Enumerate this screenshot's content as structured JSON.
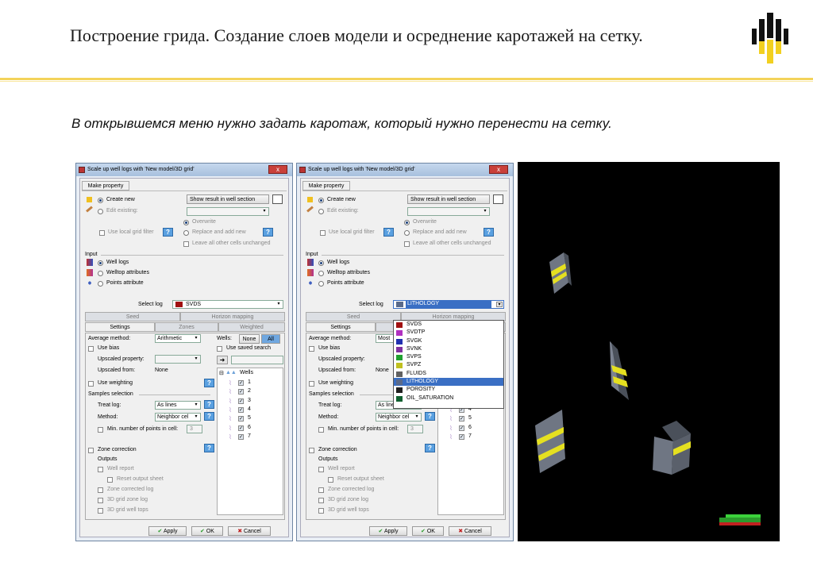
{
  "slide": {
    "title": "Построение грида. Создание слоев модели и осреднение каротажей на сетку.",
    "subtitle": "В открывшемся меню нужно задать каротаж, который нужно перенести на сетку."
  },
  "dialog": {
    "title": "Scale up well logs with 'New model/3D grid'",
    "close": "x",
    "section_tab": "Make property",
    "create_new": "Create new",
    "edit_existing": "Edit existing:",
    "show_result": "Show result in well section",
    "use_local_grid_filter": "Use local grid filter",
    "overwrite": "Overwrite",
    "replace_add": "Replace and add new",
    "leave_cells": "Leave all other cells unchanged",
    "input_label": "Input",
    "well_logs": "Well logs",
    "welltop_attributes": "Welltop attributes",
    "points_attribute": "Points attribute",
    "select_log_label": "Select log",
    "tabs_row1": [
      "Seed",
      "Horizon mapping"
    ],
    "tabs_row2": [
      "Settings",
      "Zones",
      "Weighted"
    ],
    "average_method_label": "Average method:",
    "use_bias": "Use bias",
    "upscaled_property": "Upscaled property:",
    "upscaled_from": "Upscaled from:",
    "upscaled_from_value": "None",
    "use_weighting": "Use weighting",
    "samples_selection": "Samples selection",
    "treat_log": "Treat log:",
    "treat_log_value": "As lines",
    "method": "Method:",
    "method_value": "Neighbor cel",
    "min_points": "Min. number of points in cell:",
    "min_points_value": "3",
    "wells_label": "Wells:",
    "none_btn": "None",
    "all_btn": "All",
    "use_saved_search": "Use saved search",
    "wells_root": "Wells",
    "wells": [
      "1",
      "2",
      "3",
      "4",
      "5",
      "6",
      "7"
    ],
    "zone_correction": "Zone correction",
    "outputs": "Outputs",
    "well_report": "Well report",
    "reset_output_sheet": "Reset output sheet",
    "zone_corrected_log": "Zone corrected log",
    "grid_zone_log": "3D grid zone log",
    "grid_well_tops": "3D grid well tops",
    "apply": "Apply",
    "ok": "OK",
    "cancel": "Cancel"
  },
  "dialog_left": {
    "select_log_value": "SVDS",
    "average_method_value": "Arithmetic"
  },
  "dialog_right": {
    "select_log_value": "LITHOLOGY",
    "average_method_value": "Most",
    "dropdown_items": [
      "SVDS",
      "SVDTP",
      "SVGK",
      "SVNK",
      "SVPS",
      "SVPZ",
      "FLUIDS",
      "LITHOLOGY",
      "POROSITY",
      "OIL_SATURATION"
    ],
    "dropdown_selected_index": 7,
    "dropdown_icon_colors": [
      "#a01010",
      "#b030c0",
      "#2030b0",
      "#8030a0",
      "#20a030",
      "#c0c020",
      "#606060",
      "#5a6a8a",
      "#202020",
      "#106030"
    ]
  },
  "colors": {
    "accent_gold": "#f3d35a",
    "selection_blue": "#3a6fc4",
    "viewport_bg": "#000000",
    "block_stripe": "#e5e020"
  }
}
